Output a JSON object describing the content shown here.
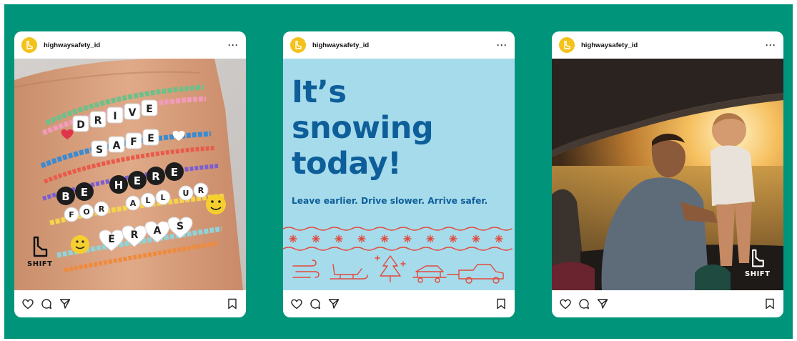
{
  "colors": {
    "background": "#00957a",
    "card": "#ffffff",
    "avatar": "#f3c21b",
    "snow_panel": "#a6dbeb",
    "headline_blue": "#0d5e99",
    "icon_red": "#e3493b"
  },
  "posts": [
    {
      "username": "highwaysafety_id",
      "more_label": "···",
      "bracelet_words": [
        "DRIVE",
        "SAFE",
        "BE HERE",
        "FOR ALL UR",
        "ERAS"
      ],
      "logo_text": "SHIFT",
      "icons": [
        "heart-icon",
        "comment-icon",
        "share-icon",
        "bookmark-icon"
      ]
    },
    {
      "username": "highwaysafety_id",
      "more_label": "···",
      "headline_lines": [
        "It’s",
        "snowing",
        "today!"
      ],
      "tagline": "Leave earlier. Drive slower. Arrive safer.",
      "icons": [
        "heart-icon",
        "comment-icon",
        "share-icon",
        "bookmark-icon"
      ]
    },
    {
      "username": "highwaysafety_id",
      "more_label": "···",
      "logo_text": "SHIFT",
      "icons": [
        "heart-icon",
        "comment-icon",
        "share-icon",
        "bookmark-icon"
      ]
    }
  ]
}
